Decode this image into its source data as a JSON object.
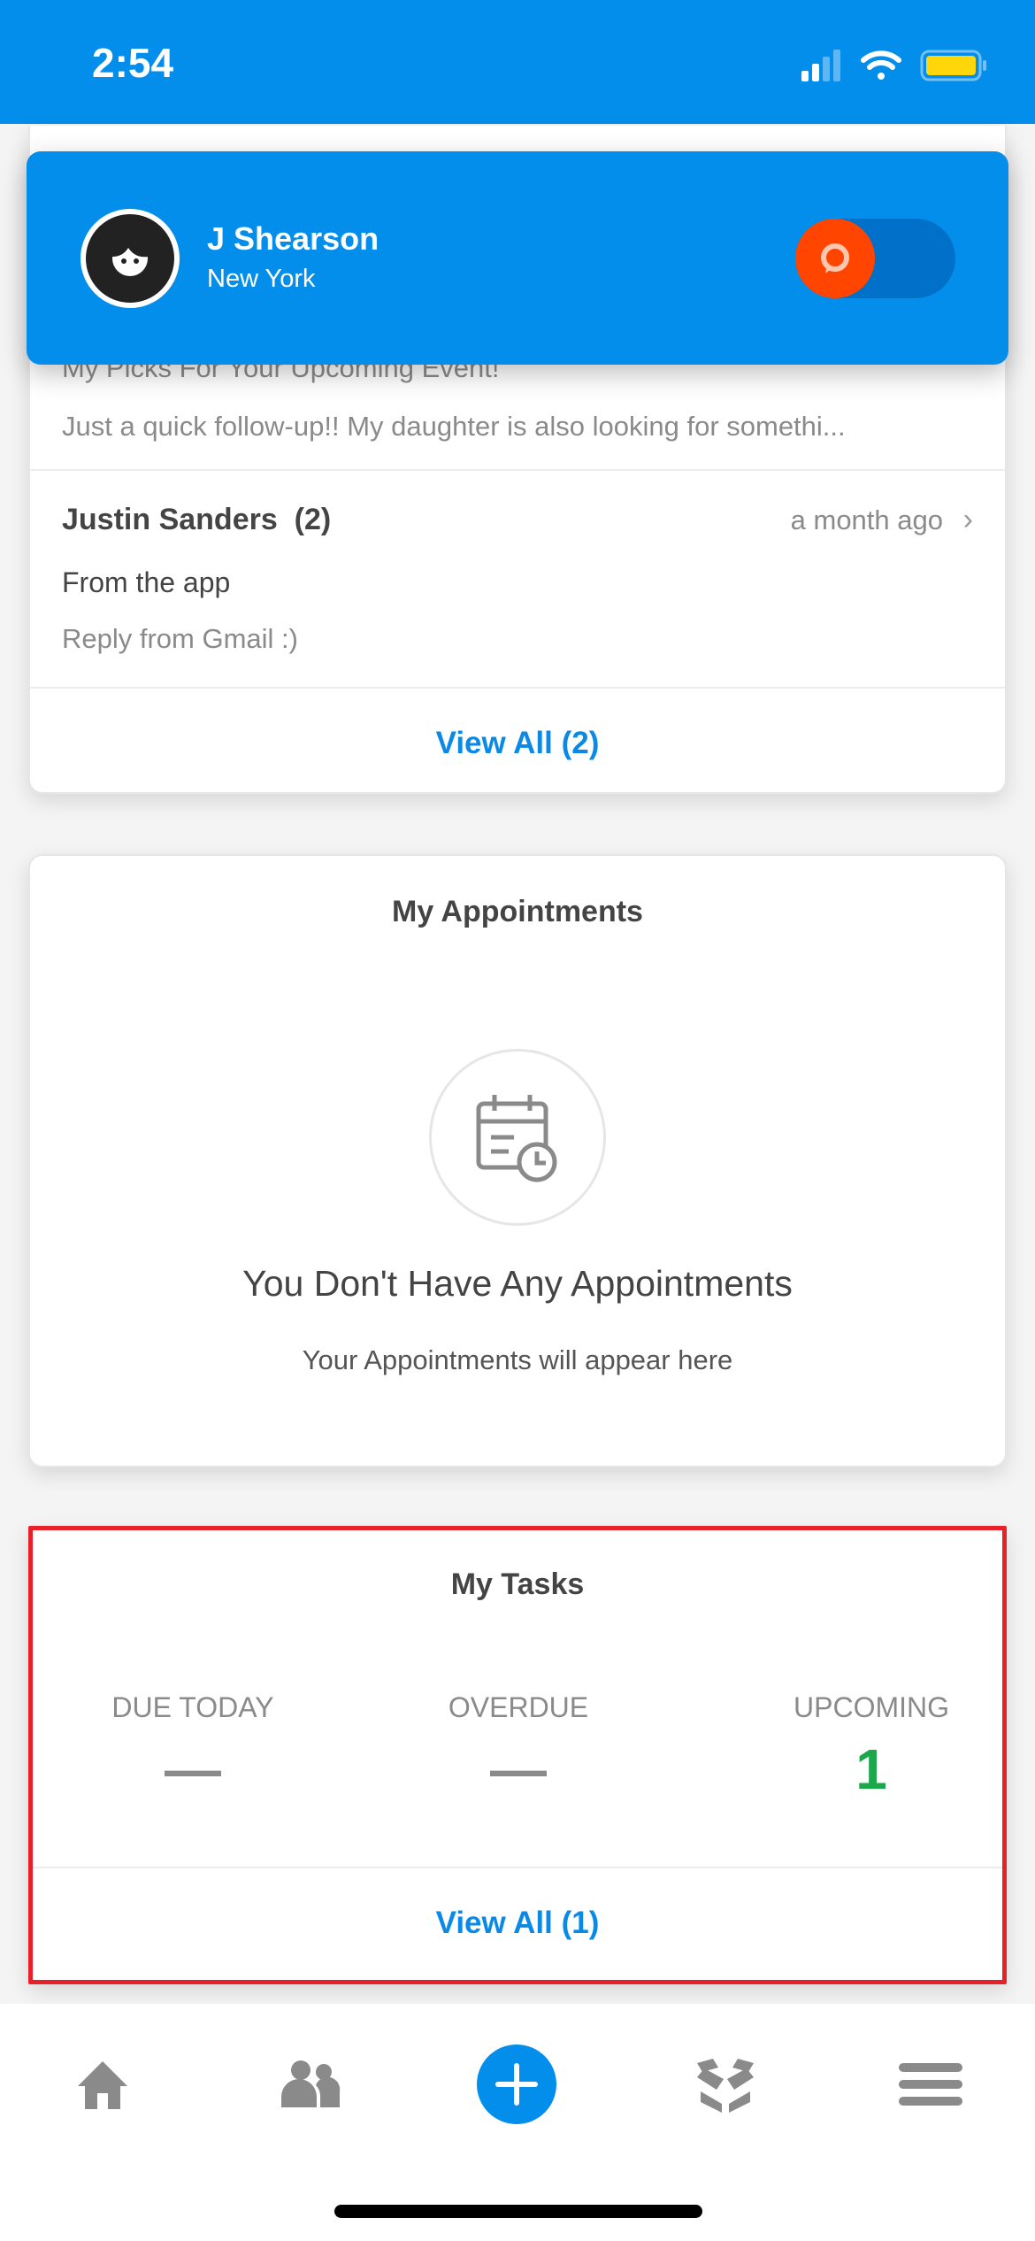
{
  "status_bar": {
    "time": "2:54",
    "colors": {
      "bar": "#028eea",
      "battery": "#ffd60a"
    }
  },
  "banner": {
    "name": "J Shearson",
    "location": "New York",
    "toggle_on": false,
    "colors": {
      "knob": "#ff4500",
      "track": "#0070c8"
    }
  },
  "messages": {
    "items": [
      {
        "subject": "My Picks For Your Upcoming Event!",
        "preview": "Just a quick follow-up!!  My daughter is also looking for somethi..."
      },
      {
        "sender": "Justin Sanders",
        "count": "(2)",
        "time": "a month ago",
        "subject": "From the app",
        "preview": "Reply from Gmail :)"
      }
    ],
    "view_all": "View All (2)"
  },
  "appointments": {
    "title": "My Appointments",
    "empty_title": "You Don't Have Any Appointments",
    "empty_subtitle": "Your Appointments will appear here",
    "icon": "calendar-clock-icon"
  },
  "tasks": {
    "title": "My Tasks",
    "columns": [
      {
        "label": "DUE TODAY",
        "value": "—"
      },
      {
        "label": "OVERDUE",
        "value": "—"
      },
      {
        "label": "UPCOMING",
        "value": "1"
      }
    ],
    "view_all": "View All (1)",
    "colors": {
      "highlight_border": "#e8202a",
      "upcoming": "#1aa84a"
    }
  },
  "bottom_nav": {
    "items": [
      "home-icon",
      "contacts-icon",
      "add-icon",
      "box-icon",
      "menu-icon"
    ],
    "accent": "#028eea"
  }
}
